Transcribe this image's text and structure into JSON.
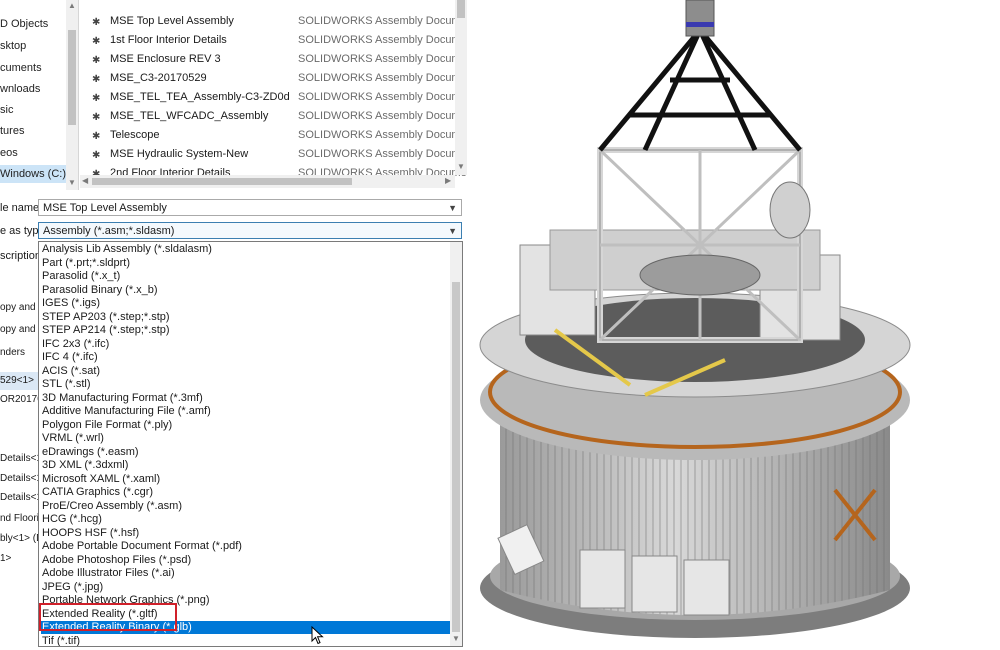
{
  "sidebar": {
    "items": [
      "D Objects",
      "sktop",
      "cuments",
      "wnloads",
      "sic",
      "tures",
      "eos",
      "Windows (C:)"
    ],
    "selected_index": 7
  },
  "files": [
    {
      "name": "MSE Top Level Assembly",
      "type": "SOLIDWORKS Assembly Document"
    },
    {
      "name": "1st Floor Interior Details",
      "type": "SOLIDWORKS Assembly Document"
    },
    {
      "name": "MSE Enclosure REV 3",
      "type": "SOLIDWORKS Assembly Document"
    },
    {
      "name": "MSE_C3-20170529",
      "type": "SOLIDWORKS Assembly Document"
    },
    {
      "name": "MSE_TEL_TEA_Assembly-C3-ZD0d",
      "type": "SOLIDWORKS Assembly Document"
    },
    {
      "name": "MSE_TEL_WFCADC_Assembly",
      "type": "SOLIDWORKS Assembly Document"
    },
    {
      "name": "Telescope",
      "type": "SOLIDWORKS Assembly Document"
    },
    {
      "name": "MSE Hydraulic System-New",
      "type": "SOLIDWORKS Assembly Document"
    },
    {
      "name": "2nd Floor Interior Details",
      "type": "SOLIDWORKS Assembly Document"
    }
  ],
  "form": {
    "file_name_label": "le name:",
    "file_name_value": "MSE Top Level Assembly",
    "save_type_label": "e as type:",
    "save_type_value": "Assembly (*.asm;*.sldasm)",
    "description_label": "scription:"
  },
  "type_options": [
    "Analysis Lib Assembly (*.sldalasm)",
    "Part (*.prt;*.sldprt)",
    "Parasolid (*.x_t)",
    "Parasolid Binary (*.x_b)",
    "IGES (*.igs)",
    "STEP AP203 (*.step;*.stp)",
    "STEP AP214 (*.step;*.stp)",
    "IFC 2x3 (*.ifc)",
    "IFC 4 (*.ifc)",
    "ACIS (*.sat)",
    "STL (*.stl)",
    "3D Manufacturing Format (*.3mf)",
    "Additive Manufacturing File (*.amf)",
    "Polygon File Format (*.ply)",
    "VRML (*.wrl)",
    "eDrawings (*.easm)",
    "3D XML (*.3dxml)",
    "Microsoft XAML (*.xaml)",
    "CATIA Graphics (*.cgr)",
    "ProE/Creo Assembly (*.asm)",
    "HCG (*.hcg)",
    "HOOPS HSF (*.hsf)",
    "Adobe Portable Document Format (*.pdf)",
    "Adobe Photoshop Files  (*.psd)",
    "Adobe Illustrator Files (*.ai)",
    "JPEG (*.jpg)",
    "Portable Network Graphics (*.png)",
    "Extended Reality (*.gltf)",
    "Extended Reality Binary (*.glb)",
    "Tif (*.tif)"
  ],
  "highlighted_option_index": 28,
  "left_tree": [
    "opy and c",
    "opy and c",
    "nders",
    "529<1>",
    "OR201704-",
    "Details<1>",
    "Details<1",
    "Details<1>",
    "nd Flooring",
    "bly<1> (D",
    "1>"
  ],
  "colors": {
    "highlight": "#0078d7",
    "annotation_box": "#d0202a",
    "selected_sidebar": "#cce4f7"
  },
  "icons": {
    "file": "solidworks-assembly-icon",
    "dropdown": "chevron-down-icon",
    "cursor": "mouse-pointer-icon"
  }
}
